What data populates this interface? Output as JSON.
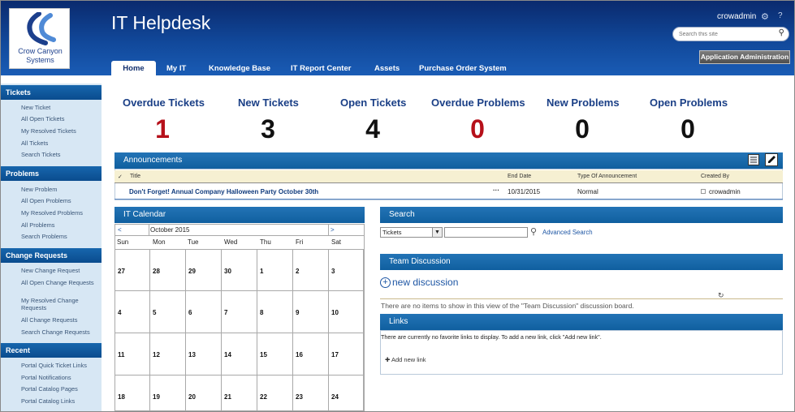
{
  "header": {
    "logo_line1": "Crow Canyon",
    "logo_line2": "Systems",
    "site_title": "IT Helpdesk",
    "user_name": "crowadmin",
    "help": "?",
    "search_placeholder": "Search this site",
    "admin_button": "Application Administration",
    "tabs": [
      {
        "label": "Home"
      },
      {
        "label": "My IT"
      },
      {
        "label": "Knowledge Base"
      },
      {
        "label": "IT Report Center"
      },
      {
        "label": "Assets"
      },
      {
        "label": "Purchase Order System"
      }
    ]
  },
  "sidebar": {
    "sections": [
      {
        "title": "Tickets",
        "items": [
          "New Ticket",
          "All Open Tickets",
          "My Resolved Tickets",
          "All Tickets",
          "Search Tickets"
        ]
      },
      {
        "title": "Problems",
        "items": [
          "New Problem",
          "All Open Problems",
          "My Resolved Problems",
          "All Problems",
          "Search Problems"
        ]
      },
      {
        "title": "Change Requests",
        "items": [
          "New Change Request",
          "All Open Change Requests",
          "My Resolved Change Requests",
          "All Change Requests",
          "Search Change Requests"
        ]
      },
      {
        "title": "Recent",
        "items": [
          "Portal Quick Ticket Links",
          "Portal Notifications",
          "Portal Catalog Pages",
          "Portal Catalog Links"
        ]
      }
    ]
  },
  "kpis": [
    {
      "label": "Overdue Tickets",
      "value": "1",
      "color": "#b6101a"
    },
    {
      "label": "New Tickets",
      "value": "3",
      "color": "#111111"
    },
    {
      "label": "Open Tickets",
      "value": "4",
      "color": "#111111"
    },
    {
      "label": "Overdue Problems",
      "value": "0",
      "color": "#b6101a"
    },
    {
      "label": "New Problems",
      "value": "0",
      "color": "#111111"
    },
    {
      "label": "Open Problems",
      "value": "0",
      "color": "#111111"
    }
  ],
  "announcements": {
    "title": "Announcements",
    "columns": {
      "title": "Title",
      "end_date": "End Date",
      "type": "Type Of Announcement",
      "created_by": "Created By"
    },
    "rows": [
      {
        "title": "Don't Forget! Annual Company Halloween Party October 30th",
        "end_date": "10/31/2015",
        "type": "Normal",
        "created_by": "crowadmin"
      }
    ]
  },
  "calendar": {
    "title": "IT Calendar",
    "prev": "<",
    "next": ">",
    "month": "October 2015",
    "day_names": [
      "Sun",
      "Mon",
      "Tue",
      "Wed",
      "Thu",
      "Fri",
      "Sat"
    ],
    "weeks": [
      [
        "27",
        "28",
        "29",
        "30",
        "1",
        "2",
        "3"
      ],
      [
        "4",
        "5",
        "6",
        "7",
        "8",
        "9",
        "10"
      ],
      [
        "11",
        "12",
        "13",
        "14",
        "15",
        "16",
        "17"
      ],
      [
        "18",
        "19",
        "20",
        "21",
        "22",
        "23",
        "24"
      ]
    ]
  },
  "search": {
    "title": "Search",
    "scope": "Tickets",
    "query": "",
    "advanced": "Advanced Search"
  },
  "team_discussion": {
    "title": "Team Discussion",
    "new_label": "new discussion",
    "empty": "There are no items to show in this view of the \"Team Discussion\" discussion board."
  },
  "links": {
    "title": "Links",
    "empty": "There are currently no favorite links to display. To add a new link, click \"Add new link\".",
    "add": "Add new link"
  }
}
